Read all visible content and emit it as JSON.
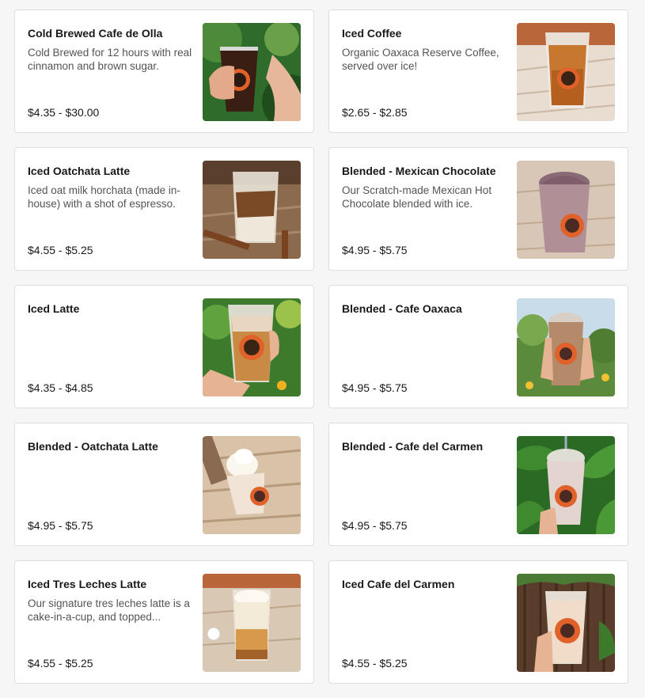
{
  "menu_items": [
    {
      "name": "Cold Brewed Cafe de Olla",
      "description": "Cold Brewed for 12 hours with real cinnamon and brown sugar.",
      "price": "$4.35 - $30.00",
      "image": "cold-brew-photo"
    },
    {
      "name": "Iced Coffee",
      "description": "Organic Oaxaca Reserve Coffee, served over ice!",
      "price": "$2.65 - $2.85",
      "image": "iced-coffee-photo"
    },
    {
      "name": "Iced Oatchata Latte",
      "description": "Iced oat milk horchata (made in-house) with a shot of espresso.",
      "price": "$4.55 - $5.25",
      "image": "oatchata-latte-photo"
    },
    {
      "name": "Blended - Mexican Chocolate",
      "description": "Our Scratch-made Mexican Hot Chocolate blended with ice.",
      "price": "$4.95 - $5.75",
      "image": "blended-chocolate-photo"
    },
    {
      "name": "Iced Latte",
      "description": "",
      "price": "$4.35 - $4.85",
      "image": "iced-latte-photo"
    },
    {
      "name": "Blended - Cafe Oaxaca",
      "description": "",
      "price": "$4.95 - $5.75",
      "image": "blended-cafe-oaxaca-photo"
    },
    {
      "name": "Blended - Oatchata Latte",
      "description": "",
      "price": "$4.95 - $5.75",
      "image": "blended-oatchata-photo"
    },
    {
      "name": "Blended - Cafe del Carmen",
      "description": "",
      "price": "$4.95 - $5.75",
      "image": "blended-cafe-del-carmen-photo"
    },
    {
      "name": "Iced Tres Leches Latte",
      "description": "Our signature tres leches latte is a cake-in-a-cup, and topped...",
      "price": "$4.55 - $5.25",
      "image": "tres-leches-photo"
    },
    {
      "name": "Iced Cafe del Carmen",
      "description": "",
      "price": "$4.55 - $5.25",
      "image": "iced-cafe-del-carmen-photo"
    }
  ],
  "colors": {
    "card_bg": "#ffffff",
    "border": "#dedede",
    "title_text": "#191919",
    "desc_text": "#545454",
    "logo_orange": "#e0622a"
  }
}
